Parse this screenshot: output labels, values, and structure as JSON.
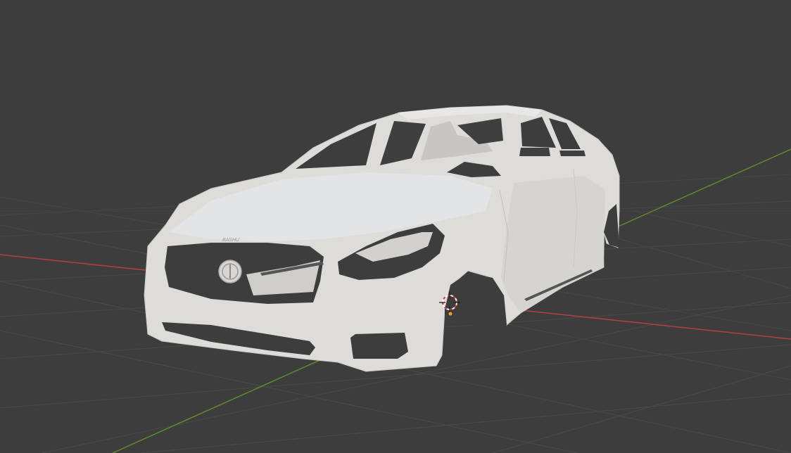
{
  "viewport": {
    "background_color": "#3d3d3d",
    "grid_color": "#4a4a4a",
    "x_axis_color": "#b53e45",
    "y_axis_color": "#5f8a2e"
  },
  "model": {
    "body_color": "#dedcd9",
    "shadow_color": "#b8b6b2",
    "grille_badge_text": "BASHU",
    "emblem_icon": "circle-emblem-icon"
  },
  "cursor": {
    "icon": "3d-cursor-icon",
    "ring_color_a": "#d93b3b",
    "ring_color_b": "#ffffff",
    "origin_color": "#f0a030"
  }
}
